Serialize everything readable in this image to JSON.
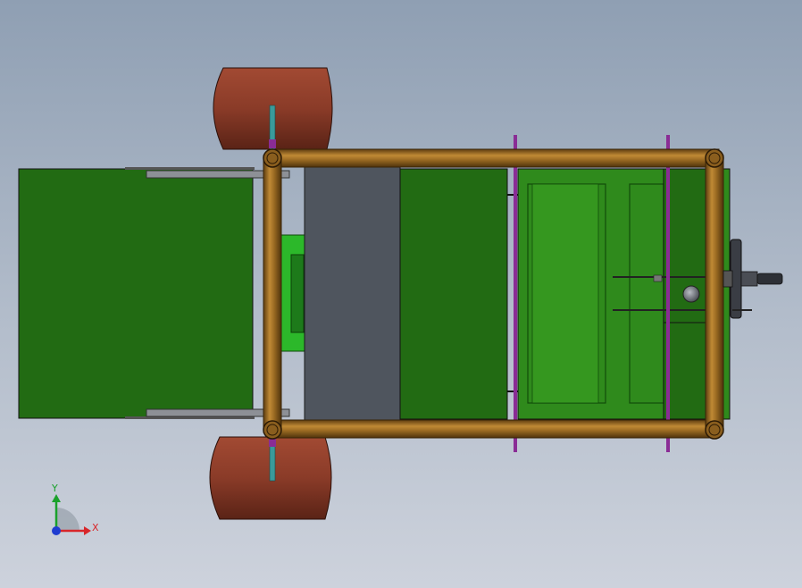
{
  "viewport": {
    "background_top": "#8f9fb3",
    "background_bottom": "#cdd2dc"
  },
  "colors": {
    "panel_dark_green": "#226b13",
    "panel_green": "#2f8a1c",
    "bright_green": "#2cb82a",
    "wheel": "#8a3b28",
    "frame_tube": "#9a6a22",
    "seat_plate": "#4f555e",
    "purple_rod": "#8a2c95",
    "axle_teal": "#3a9a9a",
    "axis_x": "#d8262a",
    "axis_y": "#1aa12b",
    "axis_z": "#1f3cd0"
  },
  "triad": {
    "x_label": "X",
    "y_label": "Y"
  },
  "icons": [
    "steering-wheel-icon",
    "coordinate-triad-icon"
  ]
}
